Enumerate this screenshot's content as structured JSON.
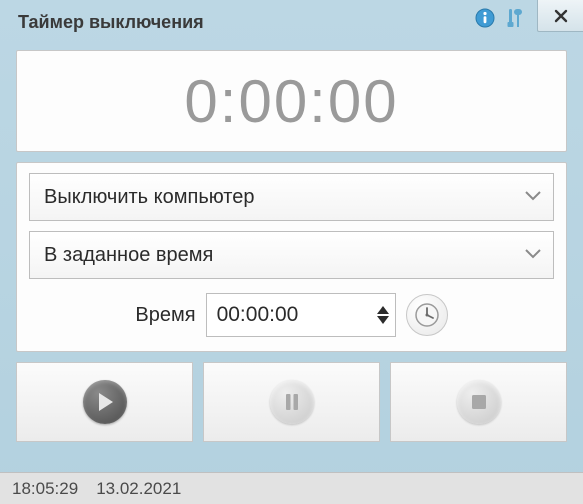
{
  "window": {
    "title": "Таймер выключения"
  },
  "timer": {
    "display": "0:00:00"
  },
  "action_dropdown": {
    "selected": "Выключить компьютер"
  },
  "mode_dropdown": {
    "selected": "В заданное время"
  },
  "time_input": {
    "label": "Время",
    "value": "00:00:00"
  },
  "statusbar": {
    "time": "18:05:29",
    "date": "13.02.2021"
  }
}
